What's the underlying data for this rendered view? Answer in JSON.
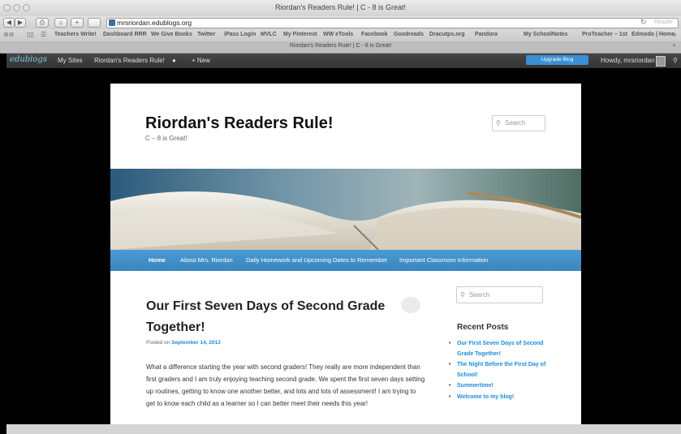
{
  "window": {
    "title": "Riordan's Readers Rule! | C - 8 is Great!"
  },
  "toolbar": {
    "url": "mrsriordan.edublogs.org",
    "reader_label": "Reader",
    "back": "◀",
    "forward": "▶",
    "print": "⎙",
    "home": "⌂",
    "add": "+"
  },
  "bookmarks": [
    "Teachers Write!",
    "Dashboard RRR",
    "We Give Books",
    "Twitter",
    "iPass Login",
    "MVLC",
    "My Pinterest",
    "WW eTools",
    "Facebook",
    "Goodreads",
    "Dracutps.org",
    "Pandora",
    "My SchoolNotes",
    "ProTeacher – 1st",
    "Edmodo | Home"
  ],
  "tab": {
    "title": "Riordan's Readers Rule! | C - 8 is Great!"
  },
  "adminbar": {
    "logo": "edublogs",
    "my_sites": "My Sites",
    "site_name": "Riordan's Readers Rule!",
    "new_label": "+ New",
    "upgrade_label": "Upgrade Blog",
    "howdy": "Howdy, mrsriordan"
  },
  "site": {
    "title": "Riordan's Readers Rule!",
    "description": "C – 8 is Great!",
    "search_placeholder": "Search"
  },
  "nav": {
    "items": [
      "Home",
      "About Mrs. Riordan",
      "Daily Homework and Upcoming Dates to Remember",
      "Important Classroom Information"
    ]
  },
  "post": {
    "title": "Our First Seven Days of Second Grade Together!",
    "posted_on": "Posted on",
    "date": "September 14, 2013",
    "body": "What a difference starting the year with second graders! They really are more independent than first graders and I am truly enjoying teaching second grade.  We spent the first seven days setting up routines, getting to know one another better, and lots and lots of assessment! I am trying to get to know each child as a learner so I can better meet their needs this year!"
  },
  "sidebar": {
    "search_placeholder": "Search",
    "recent_heading": "Recent Posts",
    "recent_posts": [
      "Our First Seven Days of Second Grade Together!",
      "The Night Before the First Day of School!",
      "Summertime!",
      "Welcome to my blog!"
    ]
  },
  "colors": {
    "nav_blue": "#3a86bf",
    "link_blue": "#1b8be0",
    "upgrade_blue": "#3b8fd4",
    "adminbar": "#333333"
  },
  "icons": {
    "search": "search-icon",
    "comment": "comment-bubble-icon"
  }
}
